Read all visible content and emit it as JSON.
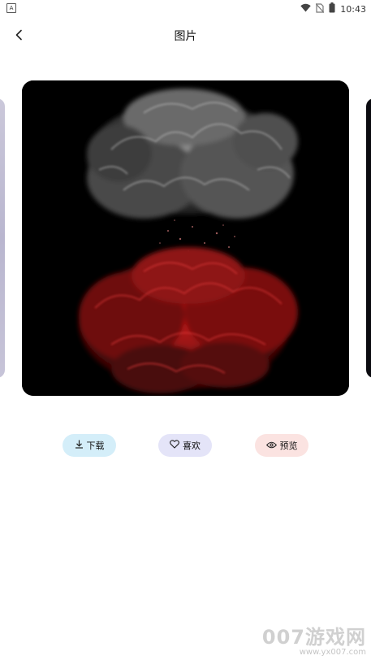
{
  "status_bar": {
    "time": "10:43",
    "left_icon": "A"
  },
  "header": {
    "title": "图片"
  },
  "actions": {
    "download_label": "下载",
    "like_label": "喜欢",
    "preview_label": "预览"
  },
  "watermark": {
    "main": "007游戏网",
    "url": "www.yx007.com"
  },
  "icons": {
    "back": "chevron-left-icon",
    "download": "download-icon",
    "like": "heart-icon",
    "preview": "eye-icon"
  },
  "colors": {
    "download_bg": "#d4eef9",
    "like_bg": "#e4e4f8",
    "preview_bg": "#fbe3e1"
  }
}
